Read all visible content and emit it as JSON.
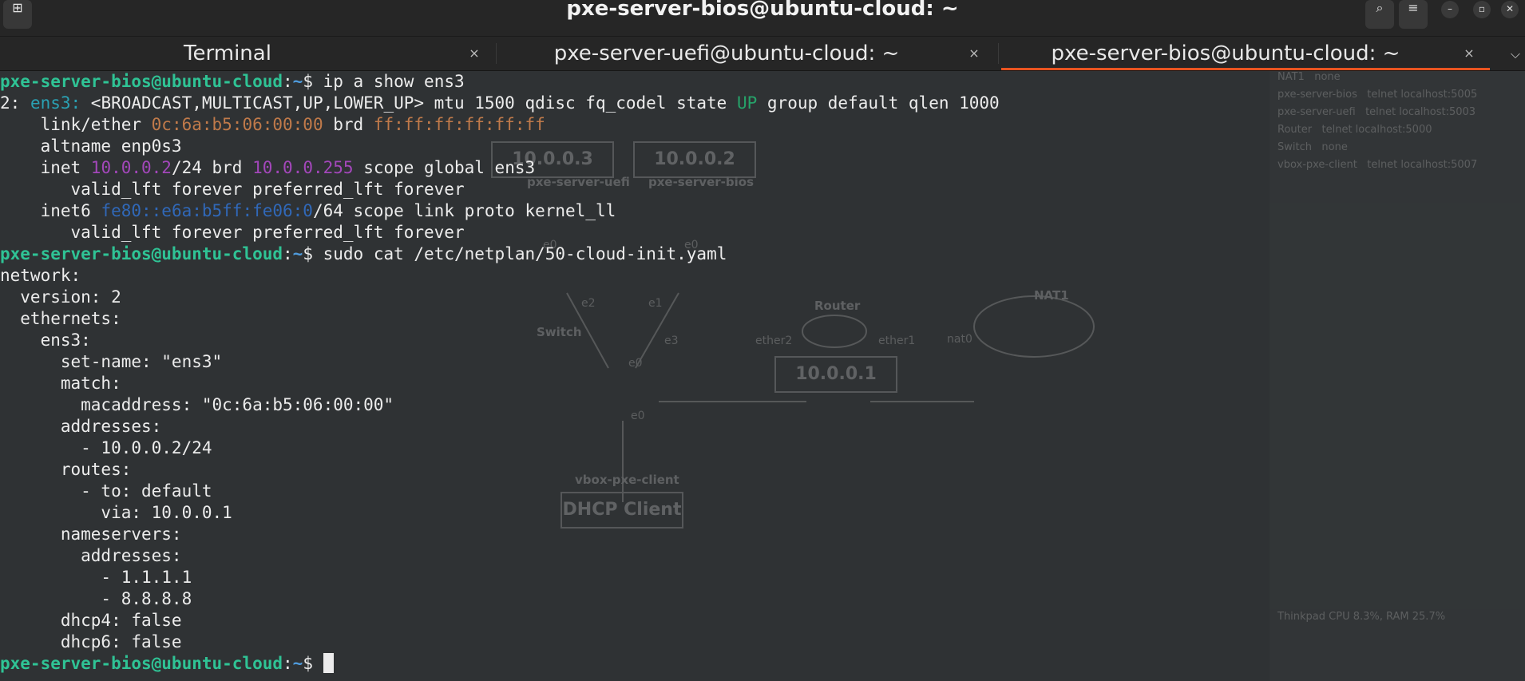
{
  "window": {
    "title": "pxe-server-bios@ubuntu-cloud: ~",
    "new_tab_icon": "new-tab-icon",
    "search_icon": "search-icon",
    "menu_icon": "hamburger-menu-icon",
    "minimize": "–",
    "maximize": "▫",
    "close": "✕"
  },
  "tabs": [
    {
      "label": "Terminal",
      "close": "×",
      "active": false
    },
    {
      "label": "pxe-server-uefi@ubuntu-cloud: ~",
      "close": "×",
      "active": false
    },
    {
      "label": "pxe-server-bios@ubuntu-cloud: ~",
      "close": "×",
      "active": true
    }
  ],
  "colors": {
    "accent": "#e95420",
    "prompt_user": "#2fc395",
    "prompt_path": "#4f9bdc",
    "background": "#2f3234"
  },
  "prompt": {
    "user_host": "pxe-server-bios@ubuntu-cloud",
    "sep": ":",
    "path": "~",
    "sign": "$"
  },
  "commands": {
    "cmd1": " ip a show ens3",
    "cmd2": " sudo cat /etc/netplan/50-cloud-init.yaml"
  },
  "ip_output": {
    "l1_num": "2: ",
    "l1_if": "ens3:",
    "l1_flags": " <BROADCAST,MULTICAST,UP,LOWER_UP> mtu 1500 qdisc fq_codel state ",
    "l1_state": "UP",
    "l1_rest": " group default qlen 1000",
    "l2_pre": "    link/ether ",
    "l2_mac": "0c:6a:b5:06:00:00",
    "l2_brd": " brd ",
    "l2_bmac": "ff:ff:ff:ff:ff:ff",
    "l3": "    altname enp0s3",
    "l4_pre": "    inet ",
    "l4_ip": "10.0.0.2",
    "l4_mid": "/24 brd ",
    "l4_bcast": "10.0.0.255",
    "l4_rest": " scope global ens3",
    "l5": "       valid_lft forever preferred_lft forever",
    "l6_pre": "    inet6 ",
    "l6_ip": "fe80::e6a:b5ff:fe06:0",
    "l6_rest": "/64 scope link proto kernel_ll",
    "l7": "       valid_lft forever preferred_lft forever"
  },
  "yaml": [
    "network:",
    "  version: 2",
    "  ethernets:",
    "    ens3:",
    "      set-name: \"ens3\"",
    "      match:",
    "        macaddress: \"0c:6a:b5:06:00:00\"",
    "      addresses:",
    "        - 10.0.0.2/24",
    "      routes:",
    "        - to: default",
    "          via: 10.0.0.1",
    "      nameservers:",
    "        addresses:",
    "          - 1.1.1.1",
    "          - 8.8.8.8",
    "      dhcp4: false",
    "      dhcp6: false"
  ],
  "background_gns3": {
    "nodes": [
      {
        "name": "NAT1",
        "console": "none"
      },
      {
        "name": "pxe-server-bios",
        "console": "telnet localhost:5005"
      },
      {
        "name": "pxe-server-uefi",
        "console": "telnet localhost:5003"
      },
      {
        "name": "Router",
        "console": "telnet localhost:5000"
      },
      {
        "name": "Switch",
        "console": "none"
      },
      {
        "name": "vbox-pxe-client",
        "console": "telnet localhost:5007"
      }
    ],
    "labels": {
      "box_uefi": "10.0.0.3",
      "box_bios": "10.0.0.2",
      "box_router": "10.0.0.1",
      "box_client": "DHCP Client",
      "uefi": "pxe-server-uefi",
      "bios": "pxe-server-bios",
      "switch": "Switch",
      "router": "Router",
      "nat": "NAT1",
      "client": "vbox-pxe-client",
      "status": "Thinkpad CPU 8.3%, RAM 25.7%"
    },
    "ports": [
      "e0",
      "e0",
      "e2",
      "e1",
      "e3",
      "e0",
      "ether2",
      "ether1",
      "nat0",
      "e0"
    ]
  }
}
